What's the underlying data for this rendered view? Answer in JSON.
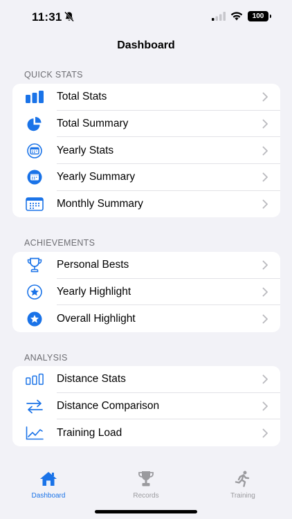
{
  "status": {
    "time": "11:31",
    "battery": "100"
  },
  "nav": {
    "title": "Dashboard"
  },
  "sections": {
    "quick_stats": {
      "header": "QUICK STATS",
      "items": [
        {
          "label": "Total Stats",
          "icon": "bar-chart-icon"
        },
        {
          "label": "Total Summary",
          "icon": "pie-chart-icon"
        },
        {
          "label": "Yearly Stats",
          "icon": "calendar-circle-icon"
        },
        {
          "label": "Yearly Summary",
          "icon": "calendar-circle-fill-icon"
        },
        {
          "label": "Monthly Summary",
          "icon": "calendar-grid-icon"
        }
      ]
    },
    "achievements": {
      "header": "ACHIEVEMENTS",
      "items": [
        {
          "label": "Personal Bests",
          "icon": "trophy-icon"
        },
        {
          "label": "Yearly Highlight",
          "icon": "star-circle-icon"
        },
        {
          "label": "Overall Highlight",
          "icon": "star-circle-fill-icon"
        }
      ]
    },
    "analysis": {
      "header": "ANALYSIS",
      "items": [
        {
          "label": "Distance Stats",
          "icon": "bar-outline-icon"
        },
        {
          "label": "Distance Comparison",
          "icon": "arrows-exchange-icon"
        },
        {
          "label": "Training Load",
          "icon": "line-chart-icon"
        }
      ]
    }
  },
  "tabs": [
    {
      "label": "Dashboard",
      "icon": "house-icon",
      "active": true
    },
    {
      "label": "Records",
      "icon": "trophy-icon",
      "active": false
    },
    {
      "label": "Training",
      "icon": "runner-icon",
      "active": false
    }
  ],
  "colors": {
    "accent": "#1a73e8",
    "inactive": "#9a9a9e",
    "chevron": "#b9b9be"
  }
}
